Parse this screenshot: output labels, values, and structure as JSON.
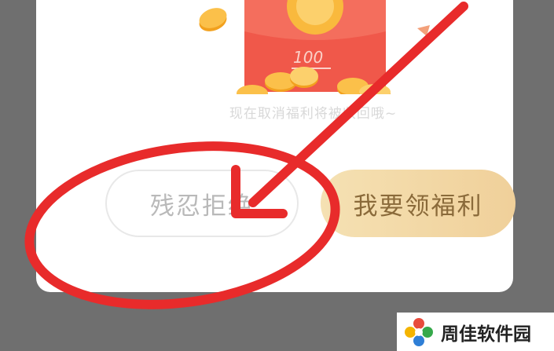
{
  "illustration": {
    "envelope_amount": "100",
    "icon": "red-envelope-with-gold-coins"
  },
  "hint_text": "现在取消福利将被收回哦~",
  "buttons": {
    "decline_label": "残忍拒绝",
    "accept_label": "我要领福利"
  },
  "annotation": {
    "color": "#e82b2b",
    "shapes": [
      "circle-around-decline-button",
      "arrow-pointing-to-decline-button"
    ]
  },
  "watermark": {
    "text": "周佳软件园"
  },
  "colors": {
    "backdrop": "#6f6f6f",
    "dialog": "#ffffff",
    "envelope": "#f0584a",
    "coin": "#f6a623",
    "accept_gradient_start": "#f5e1b3",
    "accept_gradient_end": "#f0d09a"
  }
}
